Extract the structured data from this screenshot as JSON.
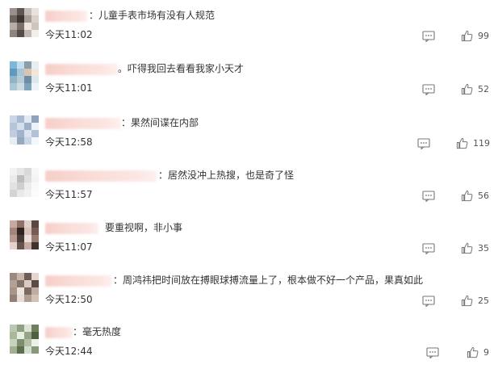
{
  "comments": [
    {
      "comment_text": "：儿童手表市场有没有人规范",
      "time": "今天11:02",
      "likes": "99",
      "avatar_colors": [
        "#9b8f8a",
        "#5d5652",
        "#c7bcb6",
        "#e8e2dd",
        "#6e625e",
        "#3b3533",
        "#a89c95",
        "#d9d0ca",
        "#b8aea8",
        "#7a6f69",
        "#ede7e2",
        "#cfc5bf",
        "#8e837d",
        "#544c48",
        "#c2b7b1",
        "#f2eee9"
      ]
    },
    {
      "comment_text": "。吓得我回去看看我家小天才",
      "time": "今天11:01",
      "likes": "52",
      "avatar_colors": [
        "#7fb7d8",
        "#c4dde9",
        "#8a9eaa",
        "#e6eef2",
        "#5e9ac0",
        "#a7c6d6",
        "#d7c4b2",
        "#f0e6de",
        "#93b4c7",
        "#b8ccd6",
        "#6c8da3",
        "#dde8ed",
        "#aec7d4",
        "#cfdbe2",
        "#7fa5bd",
        "#edf3f6"
      ]
    },
    {
      "comment_text": "：果然间谍在内部",
      "time": "今天12:58",
      "likes": "119",
      "avatar_colors": [
        "#c9d6e6",
        "#a9b9cf",
        "#e3e9f1",
        "#8fa2bb",
        "#b7c5d8",
        "#d5dfeb",
        "#9eb0c6",
        "#eef2f7",
        "#c0cde0",
        "#a1b3ca",
        "#dbe3ee",
        "#b2c1d5",
        "#e8edf4",
        "#96a9c1",
        "#cad6e5",
        "#f3f6fa"
      ]
    },
    {
      "comment_text": "：居然没冲上热搜，也是奇了怪",
      "time": "今天11:57",
      "likes": "56",
      "avatar_colors": [
        "#f2f2f2",
        "#e6e6e6",
        "#d9d9d9",
        "#f7f7f7",
        "#ebebeb",
        "#bdbdbd",
        "#dedede",
        "#f4f4f4",
        "#e2e2e2",
        "#cfcfcf",
        "#ececec",
        "#f9f9f9",
        "#d4d4d4",
        "#e9e9e9",
        "#f0f0f0",
        "#fbfbfb"
      ]
    },
    {
      "comment_text": "要重视啊，非小事",
      "time": "今天11:07",
      "likes": "35",
      "avatar_colors": [
        "#c8a9a0",
        "#8f6f67",
        "#e0cfc9",
        "#5b4741",
        "#a4857c",
        "#2f2422",
        "#d6c1ba",
        "#765c55",
        "#b99a91",
        "#4a3a36",
        "#ecdfda",
        "#9a7b72",
        "#e4d3cd",
        "#6a524c",
        "#c5aba3",
        "#3e312e"
      ]
    },
    {
      "comment_text": "：周鸿祎把时间放在搏眼球搏流量上了，根本做不好一个产品，果真如此",
      "time": "今天12:50",
      "likes": "25",
      "avatar_colors": [
        "#9c8a80",
        "#c7b5aa",
        "#6f5e55",
        "#e2d6ce",
        "#b4a195",
        "#857368",
        "#d9cbc2",
        "#5a4b44",
        "#a89589",
        "#ede4de",
        "#7c6a60",
        "#c0ada2",
        "#938075",
        "#e8ddd6",
        "#b09c90",
        "#d1c2b8"
      ]
    },
    {
      "comment_text": "：毫无热度",
      "time": "今天12:44",
      "likes": "9",
      "avatar_colors": [
        "#bcc7b3",
        "#8fa07f",
        "#dde4d6",
        "#6e7f5e",
        "#a9b79b",
        "#e8ede2",
        "#95a586",
        "#4f6040",
        "#c9d3c0",
        "#7d8e6c",
        "#b3c0a6",
        "#edf1e8",
        "#a1b092",
        "#5e6f4e",
        "#d4dccb",
        "#889979"
      ]
    }
  ],
  "icons": {
    "reply": "comment-icon",
    "like": "thumbs-up-icon"
  }
}
